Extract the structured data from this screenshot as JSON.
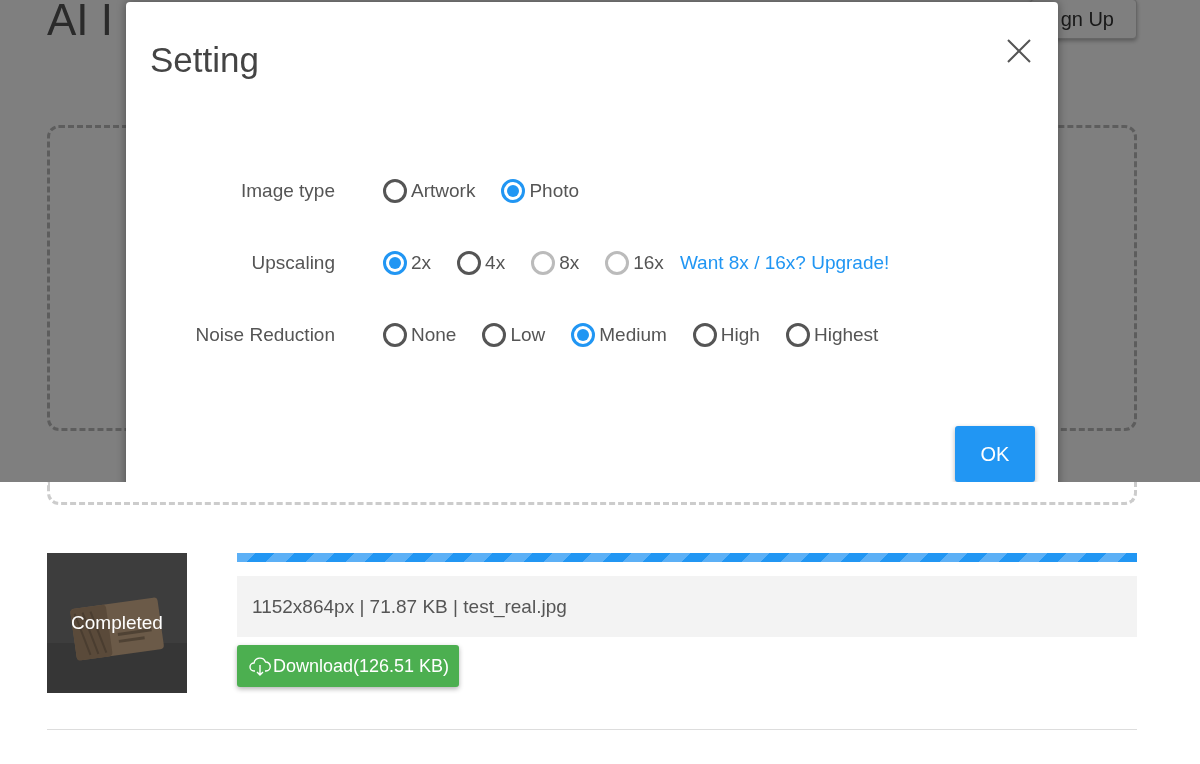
{
  "page": {
    "heading": "AI I",
    "signup_button": "gn Up"
  },
  "dialog": {
    "title": "Setting",
    "rows": [
      {
        "label": "Image type",
        "options": [
          {
            "label": "Artwork",
            "selected": false,
            "disabled": false
          },
          {
            "label": "Photo",
            "selected": true,
            "disabled": false
          }
        ]
      },
      {
        "label": "Upscaling",
        "options": [
          {
            "label": "2x",
            "selected": true,
            "disabled": false
          },
          {
            "label": "4x",
            "selected": false,
            "disabled": false
          },
          {
            "label": "8x",
            "selected": false,
            "disabled": true
          },
          {
            "label": "16x",
            "selected": false,
            "disabled": true
          }
        ],
        "link": "Want 8x / 16x? Upgrade!"
      },
      {
        "label": "Noise Reduction",
        "options": [
          {
            "label": "None",
            "selected": false,
            "disabled": false
          },
          {
            "label": "Low",
            "selected": false,
            "disabled": false
          },
          {
            "label": "Medium",
            "selected": true,
            "disabled": false
          },
          {
            "label": "High",
            "selected": false,
            "disabled": false
          },
          {
            "label": "Highest",
            "selected": false,
            "disabled": false
          }
        ]
      }
    ],
    "ok_button": "OK"
  },
  "result": {
    "thumbnail": {
      "kind": "picture",
      "status": "Completed"
    },
    "progress": {
      "level": 1
    },
    "info": "1152x864px | 71.87 KB | test_real.jpg",
    "download_button": "Download(126.51 KB)"
  }
}
